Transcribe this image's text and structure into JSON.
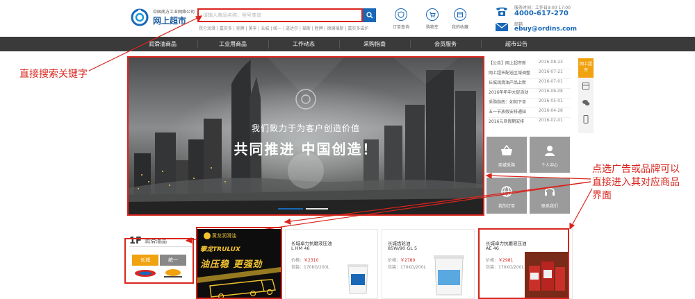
{
  "header": {
    "logo_sub": "中国南方工业网络公司",
    "logo_main": "网上超市",
    "search": {
      "placeholder": "请输入商品名称，型号查询"
    },
    "hot_words": "昆仑润滑 | 嘉实多 | 壳牌 | 美孚 | 长城 | 统一 | 道达尔 | 福斯 | 胜牌 | 德国福斯 | 嘉实多磁护",
    "services": [
      {
        "label": "订单查询"
      },
      {
        "label": "购物车"
      },
      {
        "label": "我的收藏"
      }
    ],
    "hours": "服务时间：工作日9:00-17:00",
    "phone": "4000-617-270",
    "email_label": "邮箱",
    "email": "ebuy@ordins.com"
  },
  "nav": {
    "items": [
      {
        "label": "润滑油商品"
      },
      {
        "label": "工业用商品"
      },
      {
        "label": "工作动态"
      },
      {
        "label": "采购指南"
      },
      {
        "label": "会员服务"
      },
      {
        "label": "超市公告"
      }
    ]
  },
  "banner": {
    "slogan_1": "我们致力于为客户创造价值",
    "slogan_2": "共同推进 中国创造！"
  },
  "news": [
    {
      "title": "【公告】网上超市新",
      "date": "2016-08-23"
    },
    {
      "title": "网上超市配送区域调整",
      "date": "2016-07-21"
    },
    {
      "title": "长城润滑油产品上新",
      "date": "2016-07-01"
    },
    {
      "title": "2016年年中大促活动",
      "date": "2016-06-08"
    },
    {
      "title": "采购指南：如何下单",
      "date": "2016-05-01"
    },
    {
      "title": "五一节放假安排通知",
      "date": "2016-04-28"
    },
    {
      "title": "2016元旦假期安排",
      "date": "2016-02-01"
    }
  ],
  "tiles": [
    {
      "label": "商城采购"
    },
    {
      "label": "个人中心"
    },
    {
      "label": "我的订单"
    },
    {
      "label": "联系我们"
    }
  ],
  "float": {
    "top_label": "网上超市"
  },
  "annotations": {
    "search_note": "直接搜索关键字",
    "ad_note_1": "点选广告或品牌可以",
    "ad_note_2": "直接进入其对应商品",
    "ad_note_3": "界面"
  },
  "floor": {
    "number": "1F",
    "name": "润滑油品",
    "brand_a": "长城",
    "brand_b": "统一"
  },
  "promo": {
    "logo": "黄龙润滑油",
    "tagline": "攀龙TRULUX",
    "headline": "油压稳 更强劲"
  },
  "products": [
    {
      "name": "长城卓力抗磨液压油",
      "spec": "L HM 46",
      "price_label": "价格：",
      "price": "￥2310",
      "pack": "包装：170KG/200L"
    },
    {
      "name": "长城齿轮油",
      "spec": "85W/90 GL 5",
      "price_label": "价格：",
      "price": "￥2780",
      "pack": "包装：170KG/200L"
    },
    {
      "name": "长城卓力抗磨液压油",
      "spec": "AE 46",
      "price_label": "价格：",
      "price": "￥2981",
      "pack": "包装：170KG/200L"
    }
  ],
  "colors": {
    "accent_red": "#d9251d",
    "brand_blue": "#1868b7",
    "nav_bg": "#3a3a3a",
    "highlight_orange": "#f1a20f"
  }
}
